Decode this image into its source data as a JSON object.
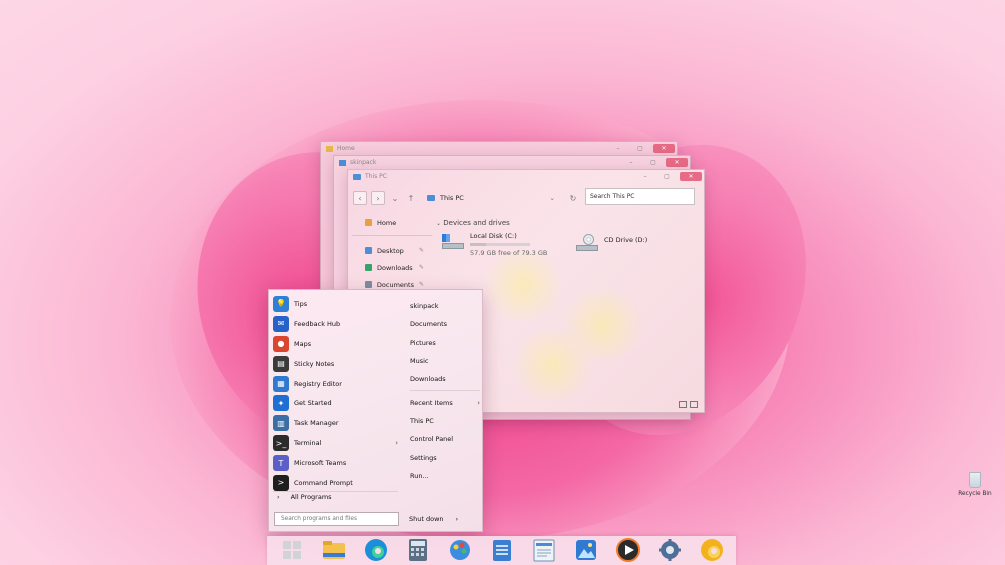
{
  "colors": {
    "accent": "#f15c9d",
    "close": "#e76b86",
    "wallpaper": "#fbb6d3"
  },
  "windows": {
    "back1": {
      "title": "Home",
      "icon": "folder-icon"
    },
    "back2": {
      "title": "skinpack",
      "icon": "folder-icon"
    },
    "main": {
      "title": "This PC",
      "address": "This PC",
      "search_placeholder": "Search This PC",
      "sidebar": [
        {
          "label": "Home",
          "icon": "home-icon",
          "pinned": false
        },
        {
          "label": "Desktop",
          "icon": "desktop-icon",
          "pinned": true
        },
        {
          "label": "Downloads",
          "icon": "downloads-icon",
          "pinned": true
        },
        {
          "label": "Documents",
          "icon": "documents-icon",
          "pinned": true
        }
      ],
      "section_title": "Devices and drives",
      "drives": [
        {
          "name": "Local Disk (C:)",
          "free": "57.9 GB free of 79.3 GB",
          "used_fraction": 0.27
        },
        {
          "name": "CD Drive (D:)"
        }
      ]
    }
  },
  "start_menu": {
    "apps": [
      {
        "label": "Tips",
        "icon": "tips-icon",
        "color": "#2f7fd7",
        "submenu": false
      },
      {
        "label": "Feedback Hub",
        "icon": "feedback-hub-icon",
        "color": "#2563c9",
        "submenu": false
      },
      {
        "label": "Maps",
        "icon": "maps-icon",
        "color": "#d9452f",
        "submenu": false
      },
      {
        "label": "Sticky Notes",
        "icon": "sticky-notes-icon",
        "color": "#3b3b3b",
        "submenu": false
      },
      {
        "label": "Registry Editor",
        "icon": "registry-editor-icon",
        "color": "#2f7ad0",
        "submenu": false
      },
      {
        "label": "Get Started",
        "icon": "get-started-icon",
        "color": "#1f6fd3",
        "submenu": false
      },
      {
        "label": "Task Manager",
        "icon": "task-manager-icon",
        "color": "#3a6ea5",
        "submenu": false
      },
      {
        "label": "Terminal",
        "icon": "terminal-icon",
        "color": "#2b2b2b",
        "submenu": true
      },
      {
        "label": "Microsoft Teams",
        "icon": "teams-icon",
        "color": "#5b5fc7",
        "submenu": false
      },
      {
        "label": "Command Prompt",
        "icon": "command-prompt-icon",
        "color": "#1e1e1e",
        "submenu": false
      }
    ],
    "all_programs": "All Programs",
    "right": [
      {
        "label": "skinpack",
        "submenu": false
      },
      {
        "label": "Documents",
        "submenu": false
      },
      {
        "label": "Pictures",
        "submenu": false
      },
      {
        "label": "Music",
        "submenu": false
      },
      {
        "label": "Downloads",
        "submenu": false
      },
      {
        "label": "Recent Items",
        "submenu": true
      },
      {
        "label": "This PC",
        "submenu": false
      },
      {
        "label": "Control Panel",
        "submenu": false
      },
      {
        "label": "Settings",
        "submenu": false
      },
      {
        "label": "Run...",
        "submenu": false
      }
    ],
    "search_placeholder": "Search programs and files",
    "shutdown": "Shut down"
  },
  "taskbar": [
    {
      "name": "start",
      "icon": "start-icon"
    },
    {
      "name": "file-explorer",
      "icon": "file-explorer-icon"
    },
    {
      "name": "edge",
      "icon": "edge-icon"
    },
    {
      "name": "calculator",
      "icon": "calculator-icon"
    },
    {
      "name": "paint",
      "icon": "paint-icon"
    },
    {
      "name": "notepad",
      "icon": "notepad-icon"
    },
    {
      "name": "wordpad",
      "icon": "wordpad-icon"
    },
    {
      "name": "photos",
      "icon": "photos-icon"
    },
    {
      "name": "media-player",
      "icon": "media-player-icon"
    },
    {
      "name": "settings",
      "icon": "settings-icon"
    },
    {
      "name": "edge-canary",
      "icon": "edge-canary-icon"
    }
  ],
  "desktop": {
    "recycle_bin": "Recycle Bin"
  }
}
